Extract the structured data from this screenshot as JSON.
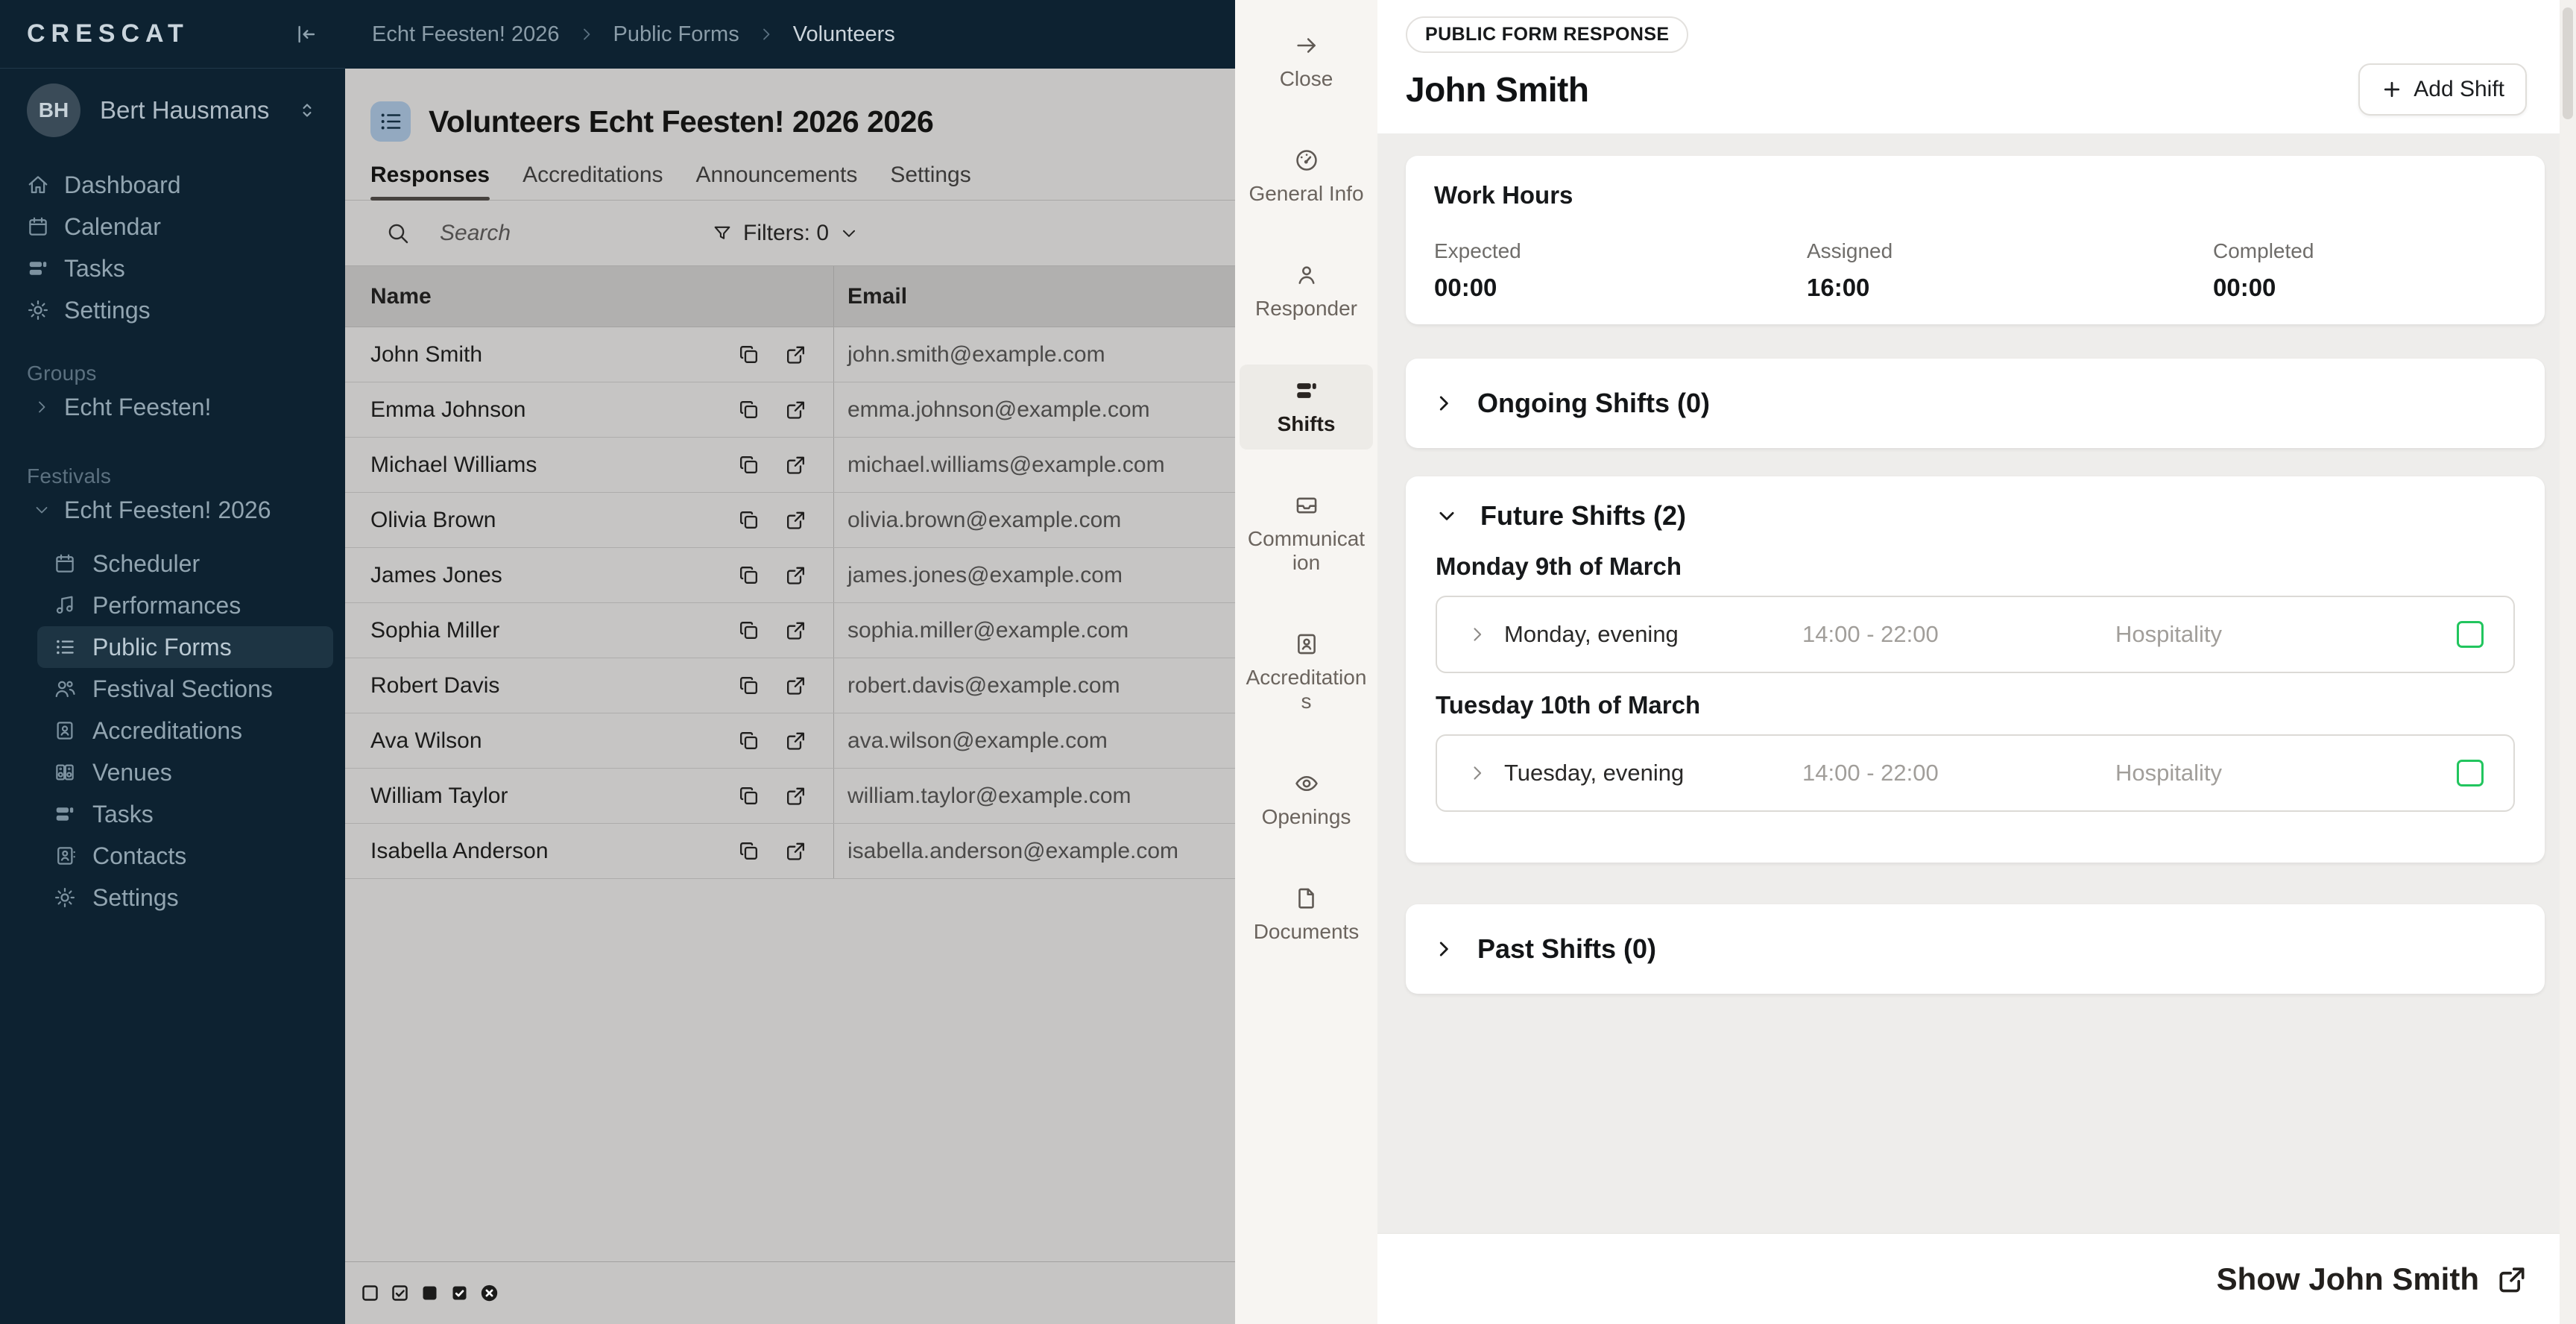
{
  "sidebar": {
    "logo": "CRESCAT",
    "user": {
      "initials": "BH",
      "name": "Bert Hausmans"
    },
    "main_items": [
      {
        "label": "Dashboard"
      },
      {
        "label": "Calendar"
      },
      {
        "label": "Tasks"
      },
      {
        "label": "Settings"
      }
    ],
    "groups_label": "Groups",
    "group_item": "Echt Feesten!",
    "festivals_label": "Festivals",
    "festival_item": "Echt Feesten! 2026",
    "festival_children": [
      {
        "label": "Scheduler"
      },
      {
        "label": "Performances"
      },
      {
        "label": "Public Forms"
      },
      {
        "label": "Festival Sections"
      },
      {
        "label": "Accreditations"
      },
      {
        "label": "Venues"
      },
      {
        "label": "Tasks"
      },
      {
        "label": "Contacts"
      },
      {
        "label": "Settings"
      }
    ]
  },
  "breadcrumb": {
    "items": [
      "Echt Feesten! 2026",
      "Public Forms",
      "Volunteers"
    ]
  },
  "list_panel": {
    "title": "Volunteers Echt Feesten! 2026 2026",
    "tabs": [
      {
        "label": "Responses"
      },
      {
        "label": "Accreditations"
      },
      {
        "label": "Announcements"
      },
      {
        "label": "Settings"
      }
    ],
    "search_placeholder": "Search",
    "filters_label": "Filters: 0",
    "columns": {
      "name": "Name",
      "email": "Email"
    },
    "rows": [
      {
        "name": "John Smith",
        "email": "john.smith@example.com"
      },
      {
        "name": "Emma Johnson",
        "email": "emma.johnson@example.com"
      },
      {
        "name": "Michael Williams",
        "email": "michael.williams@example.com"
      },
      {
        "name": "Olivia Brown",
        "email": "olivia.brown@example.com"
      },
      {
        "name": "James Jones",
        "email": "james.jones@example.com"
      },
      {
        "name": "Sophia Miller",
        "email": "sophia.miller@example.com"
      },
      {
        "name": "Robert Davis",
        "email": "robert.davis@example.com"
      },
      {
        "name": "Ava Wilson",
        "email": "ava.wilson@example.com"
      },
      {
        "name": "William Taylor",
        "email": "william.taylor@example.com"
      },
      {
        "name": "Isabella Anderson",
        "email": "isabella.anderson@example.com"
      }
    ]
  },
  "detail_toolbar": {
    "items": [
      {
        "label": "Close"
      },
      {
        "label": "General Info"
      },
      {
        "label": "Responder"
      },
      {
        "label": "Shifts"
      },
      {
        "label": "Communication"
      },
      {
        "label": "Accreditations"
      },
      {
        "label": "Openings"
      },
      {
        "label": "Documents"
      }
    ]
  },
  "detail_panel": {
    "badge": "PUBLIC FORM RESPONSE",
    "title": "John Smith",
    "add_shift_label": "Add Shift",
    "work_hours": {
      "title": "Work Hours",
      "stats": [
        {
          "label": "Expected",
          "value": "00:00"
        },
        {
          "label": "Assigned",
          "value": "16:00"
        },
        {
          "label": "Completed",
          "value": "00:00"
        }
      ]
    },
    "ongoing": {
      "title": "Ongoing Shifts (0)"
    },
    "future": {
      "title": "Future Shifts (2)",
      "groups": [
        {
          "date": "Monday 9th of March",
          "shifts": [
            {
              "name": "Monday, evening",
              "time": "14:00 - 22:00",
              "department": "Hospitality"
            }
          ]
        },
        {
          "date": "Tuesday 10th of March",
          "shifts": [
            {
              "name": "Tuesday, evening",
              "time": "14:00 - 22:00",
              "department": "Hospitality"
            }
          ]
        }
      ]
    },
    "past": {
      "title": "Past Shifts (0)"
    },
    "footer_link": "Show John Smith"
  },
  "colors": {
    "sidebar_bg": "#0d2231",
    "accent_green": "#22c55e",
    "toolbar_bg": "#f7f5f2"
  }
}
